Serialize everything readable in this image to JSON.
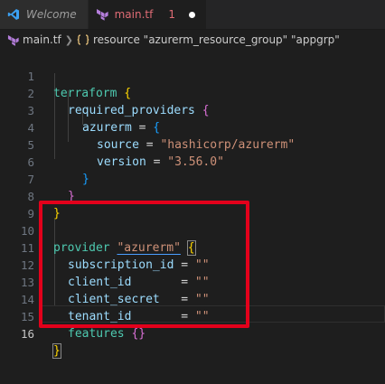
{
  "tabs": [
    {
      "label": "Welcome",
      "icon": "vscode-icon",
      "active": false
    },
    {
      "label": "main.tf",
      "icon": "terraform-icon",
      "badge": "1",
      "modified": true,
      "active": true
    }
  ],
  "breadcrumb": {
    "file": "main.tf",
    "symbol": "resource \"azurerm_resource_group\" \"appgrp\""
  },
  "line_numbers": [
    "1",
    "2",
    "3",
    "4",
    "5",
    "6",
    "7",
    "8",
    "9",
    "10",
    "11",
    "12",
    "13",
    "14",
    "15",
    "16"
  ],
  "code": {
    "l1_kw": "terraform",
    "l1_br": "{",
    "l2_key": "required_providers",
    "l2_br": "{",
    "l3_key": "azurerm",
    "l3_eq": " = ",
    "l3_br": "{",
    "l4_key": "source",
    "l4_eq": " = ",
    "l4_val": "\"hashicorp/azurerm\"",
    "l5_key": "version",
    "l5_eq": " = ",
    "l5_val": "\"3.56.0\"",
    "l6_br": "}",
    "l7_br": "}",
    "l8_br": "}",
    "l10_kw": "provider",
    "l10_name": "\"azurerm\"",
    "l10_br": "{",
    "l11_key": "subscription_id",
    "l11_eq": " = ",
    "l11_val": "\"\"",
    "l12_key": "client_id",
    "l12_eq": "       = ",
    "l12_val": "\"\"",
    "l13_key": "client_secret",
    "l13_eq": "   = ",
    "l13_val": "\"\"",
    "l14_key": "tenant_id",
    "l14_eq": "       = ",
    "l14_val": "\"\"",
    "l15_key": "features",
    "l15_br": "{}",
    "l16_br": "}"
  },
  "colors": {
    "highlight_box": "#e3001b",
    "keyword": "#4ec9b0",
    "string": "#ce9178",
    "property": "#9cdcfe"
  }
}
